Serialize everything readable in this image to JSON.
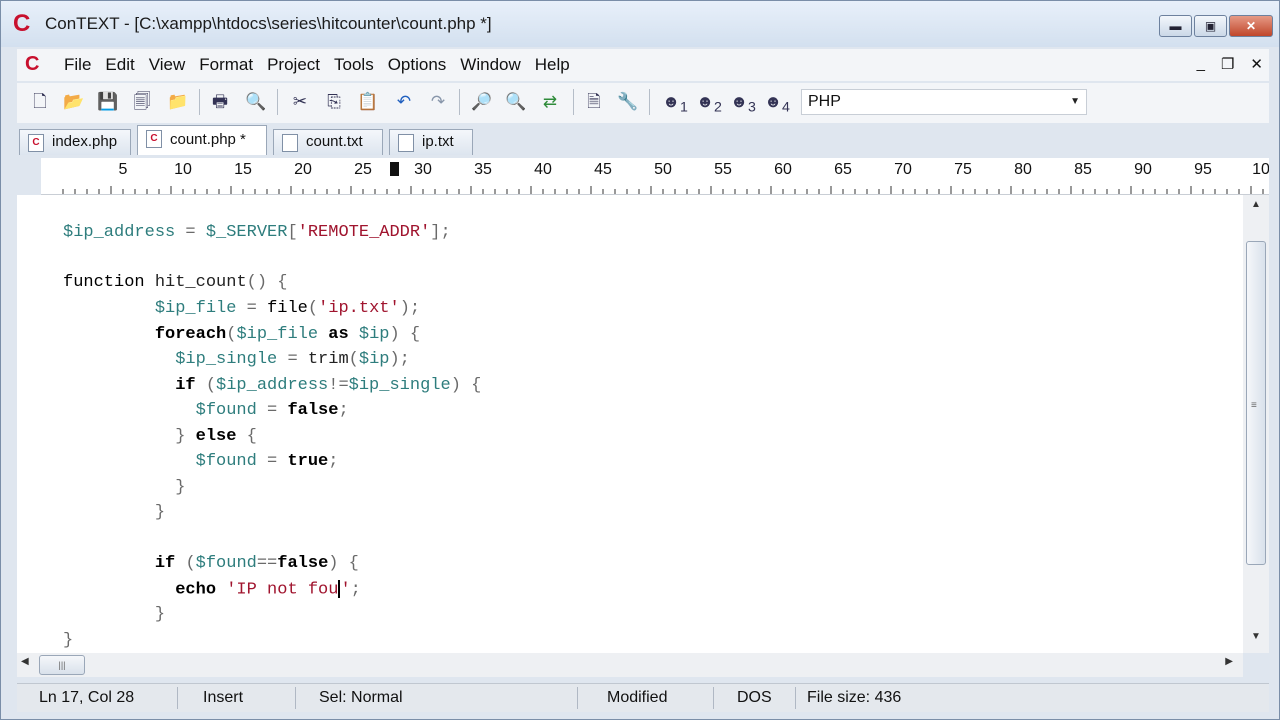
{
  "window": {
    "title": "ConTEXT - [C:\\xampp\\htdocs\\series\\hitcounter\\count.php *]",
    "logo_letter": "C",
    "minimize_glyph": "▬",
    "maximize_glyph": "▣",
    "close_glyph": "✕"
  },
  "menu": {
    "items": [
      "File",
      "Edit",
      "View",
      "Format",
      "Project",
      "Tools",
      "Options",
      "Window",
      "Help"
    ],
    "mdi_minimize": "_",
    "mdi_restore": "❐",
    "mdi_close": "✕"
  },
  "toolbar": {
    "language": "PHP",
    "icons": [
      "new-file-icon",
      "open-file-icon",
      "save-icon",
      "save-all-icon",
      "open-folder-icon",
      "print-icon",
      "print-preview-icon",
      "cut-icon",
      "copy-icon",
      "paste-icon",
      "undo-icon",
      "redo-icon",
      "find-icon",
      "find-next-icon",
      "replace-icon",
      "export-icon",
      "tools-icon",
      "user-tool-1-icon",
      "user-tool-2-icon",
      "user-tool-3-icon",
      "user-tool-4-icon"
    ],
    "user_tool_labels": [
      "1",
      "2",
      "3",
      "4"
    ]
  },
  "tabs": [
    {
      "label": "index.php",
      "active": false
    },
    {
      "label": "count.php *",
      "active": true
    },
    {
      "label": "count.txt",
      "active": false
    },
    {
      "label": "ip.txt",
      "active": false
    }
  ],
  "ruler": {
    "numbers": [
      "5",
      "10",
      "15",
      "20",
      "25",
      "30",
      "35",
      "40",
      "45",
      "50",
      "55",
      "60",
      "65",
      "70",
      "75",
      "80",
      "85",
      "90",
      "95",
      "10"
    ],
    "cursor_column": 28
  },
  "editor": {
    "lines": [
      "$ip_address = $_SERVER['REMOTE_ADDR'];",
      "",
      "function hit_count() {",
      "         $ip_file = file('ip.txt');",
      "         foreach($ip_file as $ip) {",
      "           $ip_single = trim($ip);",
      "           if ($ip_address!=$ip_single) {",
      "             $found = false;",
      "           } else {",
      "             $found = true;",
      "           }",
      "         }",
      "",
      "         if ($found==false) {",
      "           echo 'IP not fou';",
      "         }",
      "}"
    ]
  },
  "status": {
    "position": "Ln 17, Col 28",
    "mode": "Insert",
    "selection": "Sel: Normal",
    "modified": "Modified",
    "format": "DOS",
    "file_size": "File size: 436"
  },
  "colors": {
    "variable": "#2e7d7d",
    "string": "#a0142e",
    "keyword": "#000000",
    "brand": "#c8102e"
  }
}
